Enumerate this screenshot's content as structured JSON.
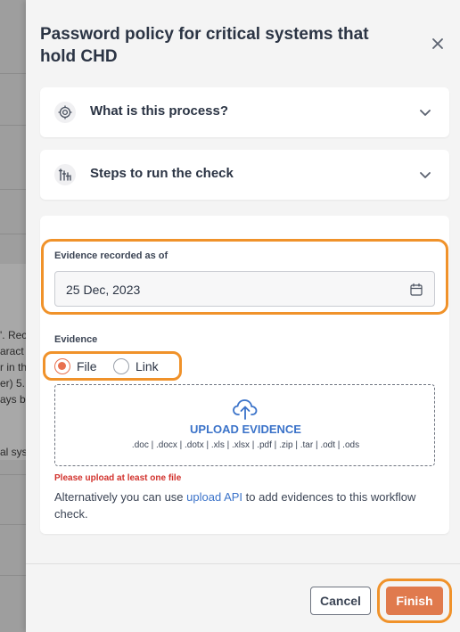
{
  "background": {
    "fragments": [
      "'. Rec",
      "aract",
      "r in th",
      "er) 5.",
      "ays b",
      "al sys"
    ]
  },
  "drawer": {
    "title": "Password policy for critical systems that hold CHD",
    "accordions": [
      {
        "title": "What is this process?",
        "icon": "process-icon"
      },
      {
        "title": "Steps to run the check",
        "icon": "steps-icon"
      }
    ],
    "evidence_form": {
      "date_label": "Evidence recorded as of",
      "date_value": "25 Dec, 2023",
      "evidence_label": "Evidence",
      "radio_options": [
        {
          "label": "File",
          "checked": true
        },
        {
          "label": "Link",
          "checked": false
        }
      ],
      "upload_title": "UPLOAD EVIDENCE",
      "upload_types": ".doc | .docx | .dotx | .xls | .xlsx | .pdf | .zip | .tar | .odt | .ods",
      "error": "Please upload at least one file",
      "alt_prefix": "Alternatively you can use ",
      "alt_link": "upload API",
      "alt_suffix": " to add evidences to this workflow check."
    },
    "footer": {
      "cancel_label": "Cancel",
      "finish_label": "Finish"
    }
  },
  "colors": {
    "accent": "#e07a4d",
    "highlight": "#f0922a",
    "link": "#3b73c9",
    "error": "#d2322d"
  }
}
